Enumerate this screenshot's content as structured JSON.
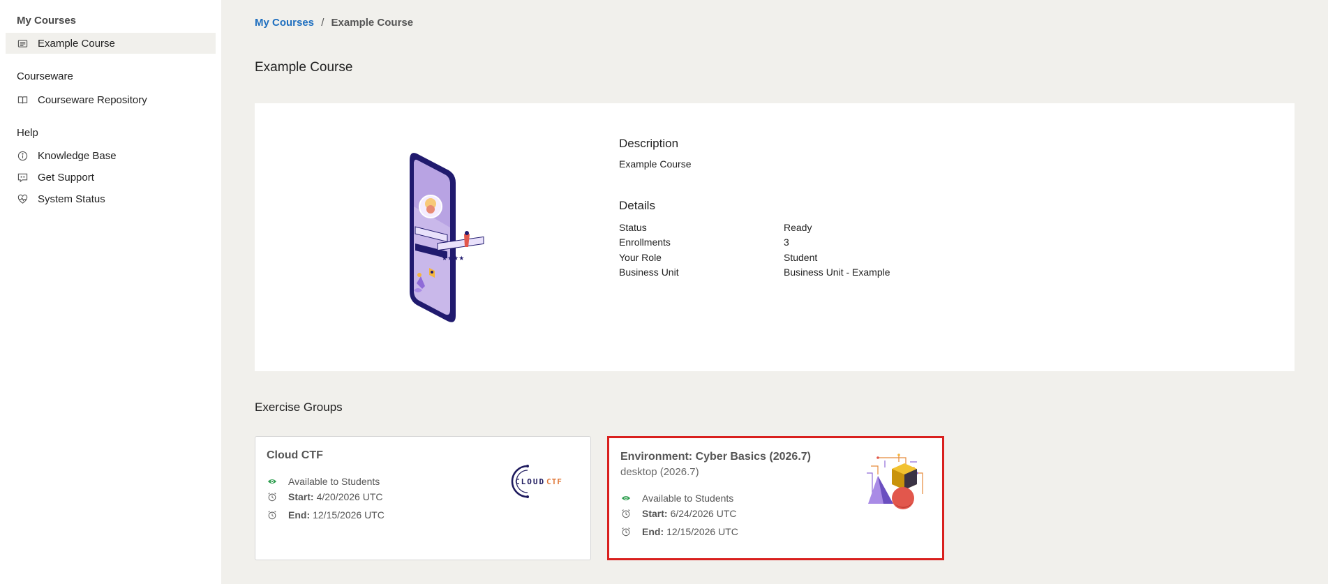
{
  "sidebar": {
    "sections": [
      {
        "title": "My Courses",
        "items": [
          {
            "label": "Example Course",
            "icon": "list-icon"
          }
        ]
      },
      {
        "title": "Courseware",
        "items": [
          {
            "label": "Courseware Repository",
            "icon": "book-icon"
          }
        ]
      },
      {
        "title": "Help",
        "items": [
          {
            "label": "Knowledge Base",
            "icon": "info-icon"
          },
          {
            "label": "Get Support",
            "icon": "chat-quote-icon"
          },
          {
            "label": "System Status",
            "icon": "heart-pulse-icon"
          }
        ]
      }
    ]
  },
  "breadcrumb": {
    "root": "My Courses",
    "separator": "/",
    "current": "Example Course"
  },
  "page": {
    "title": "Example Course"
  },
  "course": {
    "description_heading": "Description",
    "description": "Example Course",
    "details_heading": "Details",
    "details": [
      {
        "key": "Status",
        "value": "Ready"
      },
      {
        "key": "Enrollments",
        "value": "3"
      },
      {
        "key": "Your Role",
        "value": "Student"
      },
      {
        "key": "Business Unit",
        "value": "Business Unit - Example"
      }
    ]
  },
  "exercise_groups": {
    "title": "Exercise Groups",
    "start_label": "Start:",
    "end_label": "End:",
    "groups": [
      {
        "name": "Cloud CTF",
        "subtitle": "",
        "availability": "Available to Students",
        "start": "4/20/2026 UTC",
        "end": "12/15/2026 UTC",
        "logo_text": "CLOUD CTF"
      },
      {
        "name": "Environment: Cyber Basics (2026.7)",
        "subtitle": "desktop (2026.7)",
        "availability": "Available to Students",
        "start": "6/24/2026 UTC",
        "end": "12/15/2026 UTC"
      }
    ]
  },
  "colors": {
    "accent_link": "#1f6fbf",
    "selected_border": "#d9201e",
    "available_eye": "#2e9e4f"
  }
}
